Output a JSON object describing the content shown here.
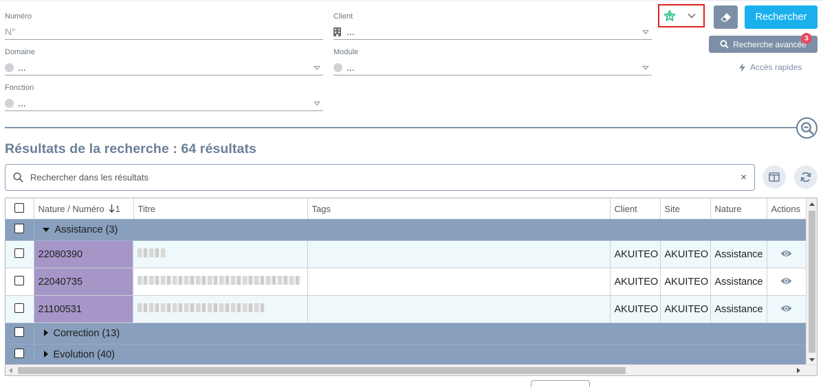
{
  "form": {
    "numero": {
      "label": "Numéro",
      "placeholder": "N°"
    },
    "client": {
      "label": "Client",
      "value": "..."
    },
    "domaine": {
      "label": "Domaine",
      "value": "..."
    },
    "module": {
      "label": "Module",
      "value": "..."
    },
    "fonction": {
      "label": "Fonction",
      "value": "..."
    }
  },
  "actions": {
    "search_label": "Rechercher",
    "advanced_label": "Recherche avancée",
    "advanced_badge": "3",
    "quick_access_label": "Accès rapides"
  },
  "results": {
    "title": "Résultats de la recherche : 64 résultats",
    "search_placeholder": "Rechercher dans les résultats",
    "clear_symbol": "×"
  },
  "grid": {
    "columns": [
      "Nature / Numéro",
      "Titre",
      "Tags",
      "Client",
      "Site",
      "Nature",
      "Actions"
    ],
    "sort_indicator": "1",
    "groups": [
      {
        "label": "Assistance (3)",
        "expanded": true,
        "rows": [
          {
            "numero": "22080390",
            "client": "AKUITEO",
            "site": "AKUITEO",
            "nature": "Assistance"
          },
          {
            "numero": "22040735",
            "client": "AKUITEO",
            "site": "AKUITEO",
            "nature": "Assistance"
          },
          {
            "numero": "21100531",
            "client": "AKUITEO",
            "site": "AKUITEO",
            "nature": "Assistance"
          }
        ]
      },
      {
        "label": "Correction (13)",
        "expanded": false
      },
      {
        "label": "Evolution (40)",
        "expanded": false
      }
    ]
  },
  "colors": {
    "primary": "#1ab0ee",
    "slate": "#7d8fa6",
    "title": "#6a7f98",
    "group_row": "#889fbd",
    "number_cell": "#a696c8",
    "favorite_star": "#2bc48a",
    "highlight_border": "#e02020"
  }
}
